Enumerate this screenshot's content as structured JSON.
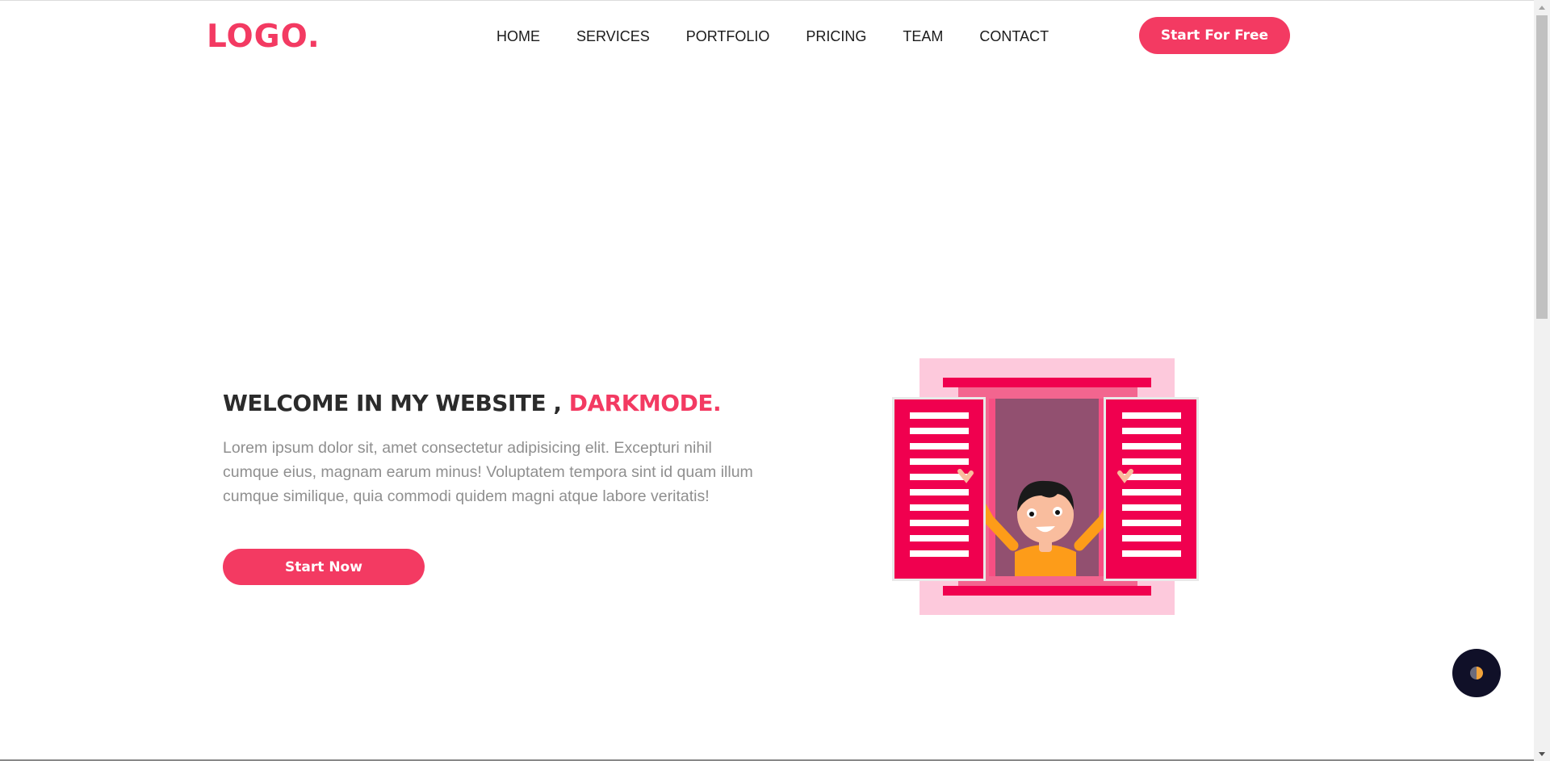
{
  "header": {
    "logo": "LOGO.",
    "nav": [
      "HOME",
      "SERVICES",
      "PORTFOLIO",
      "PRICING",
      "TEAM",
      "CONTACT"
    ],
    "cta_label": "Start For Free"
  },
  "hero": {
    "title_main": "WELCOME IN MY WEBSITE , ",
    "title_accent": "DARKMODE.",
    "text": "Lorem ipsum dolor sit, amet consectetur adipisicing elit. Excepturi nihil cumque eius, magnam earum minus! Voluptatem tempora sint id quam illum cumque similique, quia commodi quidem magni atque labore veritatis!",
    "cta_label": "Start Now"
  },
  "illustration": {
    "icon": "window-person-illustration"
  },
  "mode_toggle": {
    "icon": "moon-icon"
  },
  "colors": {
    "accent": "#f33a62",
    "toggle_bg": "#101028"
  }
}
